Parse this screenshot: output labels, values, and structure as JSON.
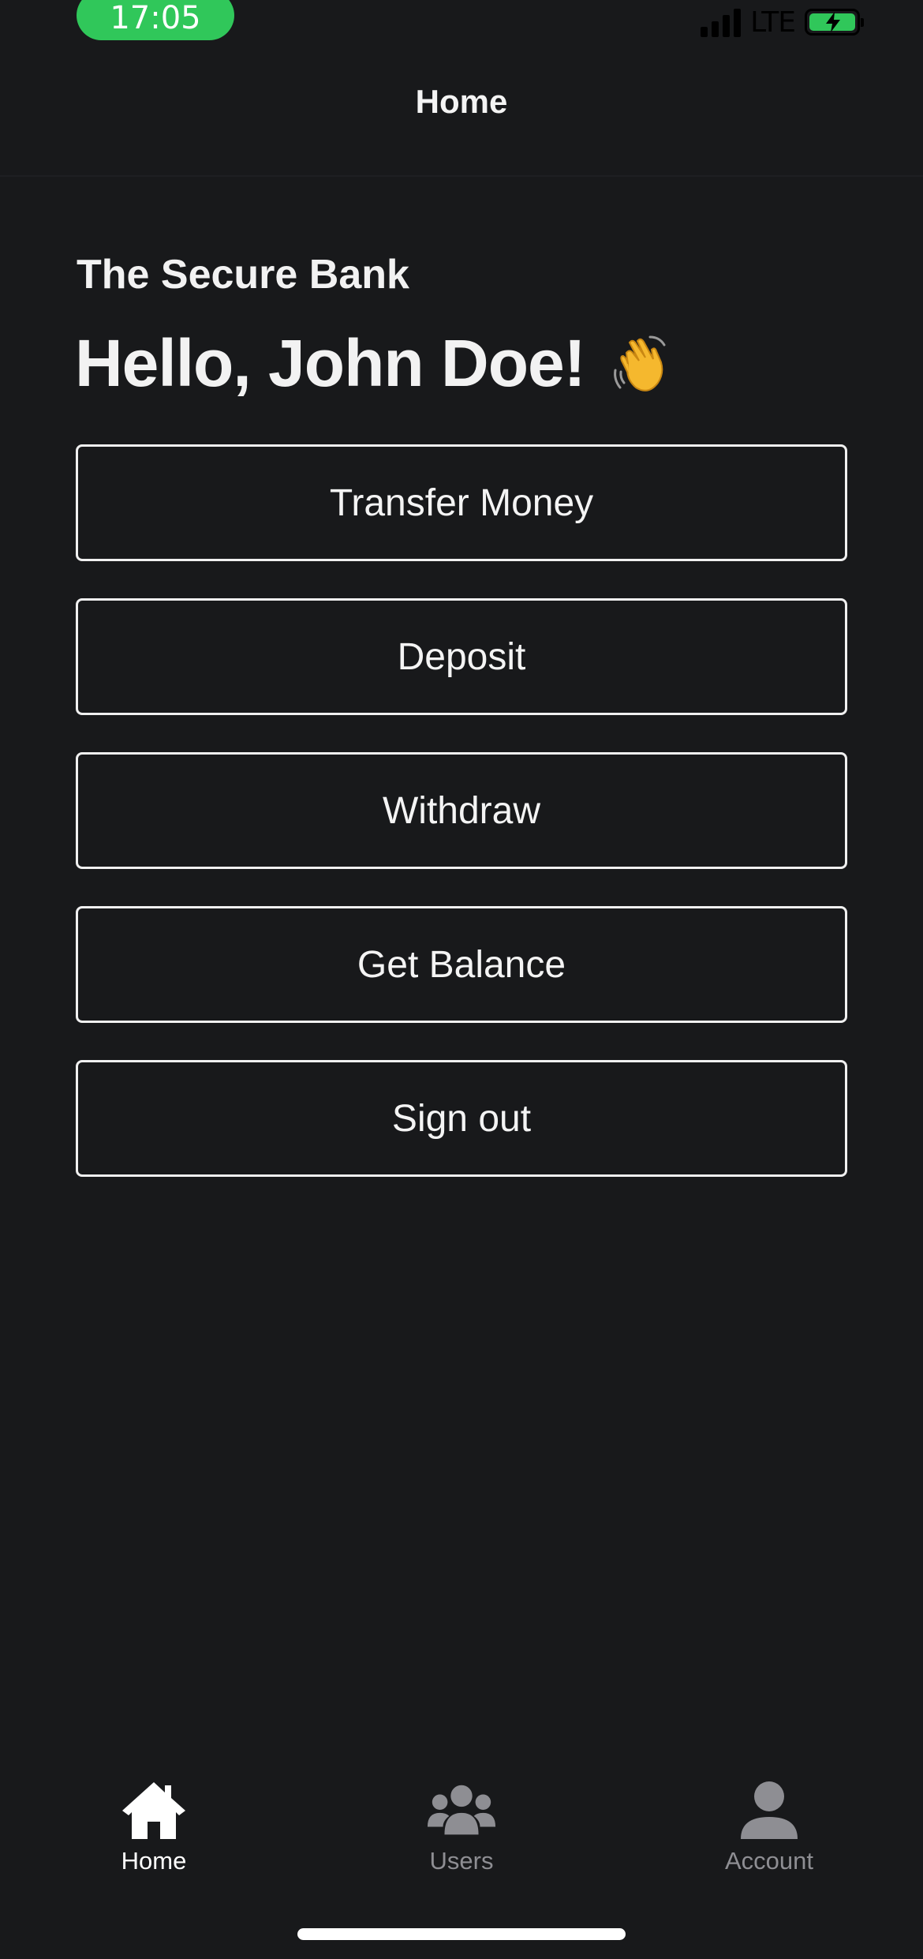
{
  "status_bar": {
    "time": "17:05",
    "network": "LTE",
    "time_pill_color": "#30c75a",
    "battery_color": "#30c75a"
  },
  "header": {
    "title": "Home"
  },
  "main": {
    "bank_name": "The Secure Bank",
    "greeting": "Hello, John Doe!",
    "greeting_icon": "waving-hand-icon",
    "actions": [
      {
        "label": "Transfer Money"
      },
      {
        "label": "Deposit"
      },
      {
        "label": "Withdraw"
      },
      {
        "label": "Get Balance"
      },
      {
        "label": "Sign out"
      }
    ]
  },
  "tab_bar": {
    "tabs": [
      {
        "label": "Home",
        "icon": "house-icon",
        "active": true
      },
      {
        "label": "Users",
        "icon": "users-icon",
        "active": false
      },
      {
        "label": "Account",
        "icon": "person-icon",
        "active": false
      }
    ]
  },
  "theme": {
    "background": "#18191b",
    "text": "#f2f2f2",
    "inactive_tab": "#8e8e93"
  }
}
